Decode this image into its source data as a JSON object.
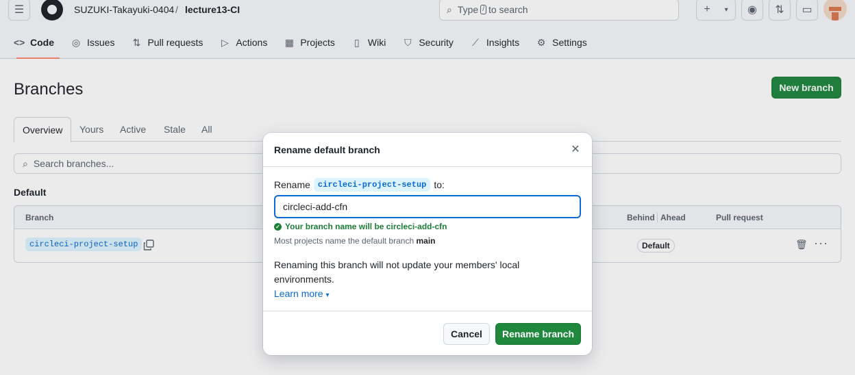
{
  "header": {
    "owner": "SUZUKI-Takayuki-0404",
    "separator": "/",
    "repo": "lecture13-CI",
    "search_placeholder_pre": "Type",
    "search_key": "/",
    "search_placeholder_post": "to search"
  },
  "nav": [
    {
      "label": "Code",
      "icon": "code-icon"
    },
    {
      "label": "Issues",
      "icon": "issue-icon"
    },
    {
      "label": "Pull requests",
      "icon": "pull-request-icon"
    },
    {
      "label": "Actions",
      "icon": "play-icon"
    },
    {
      "label": "Projects",
      "icon": "table-icon"
    },
    {
      "label": "Wiki",
      "icon": "book-icon"
    },
    {
      "label": "Security",
      "icon": "shield-icon"
    },
    {
      "label": "Insights",
      "icon": "graph-icon"
    },
    {
      "label": "Settings",
      "icon": "gear-icon"
    }
  ],
  "page": {
    "title": "Branches",
    "new_branch": "New branch",
    "tabs": [
      "Overview",
      "Yours",
      "Active",
      "Stale",
      "All"
    ],
    "search_placeholder": "Search branches...",
    "section": "Default",
    "columns": {
      "branch": "Branch",
      "behind": "Behind",
      "ahead": "Ahead",
      "pr": "Pull request"
    },
    "row": {
      "branch": "circleci-project-setup",
      "badge": "Default"
    }
  },
  "dialog": {
    "title": "Rename default branch",
    "rename_label": "Rename",
    "current_branch": "circleci-project-setup",
    "to_label": "to:",
    "input_value": "circleci-add-cfn",
    "ok_message": "Your branch name will be circleci-add-cfn",
    "hint_pre": "Most projects name the default branch",
    "hint_branch": "main",
    "warning": "Renaming this branch will not update your members' local environments.",
    "learn_more": "Learn more",
    "cancel": "Cancel",
    "confirm": "Rename branch"
  },
  "colors": {
    "primary": "#1f883d",
    "link": "#0969da",
    "success": "#1a7f37",
    "nav_underline": "#fd8c73"
  }
}
